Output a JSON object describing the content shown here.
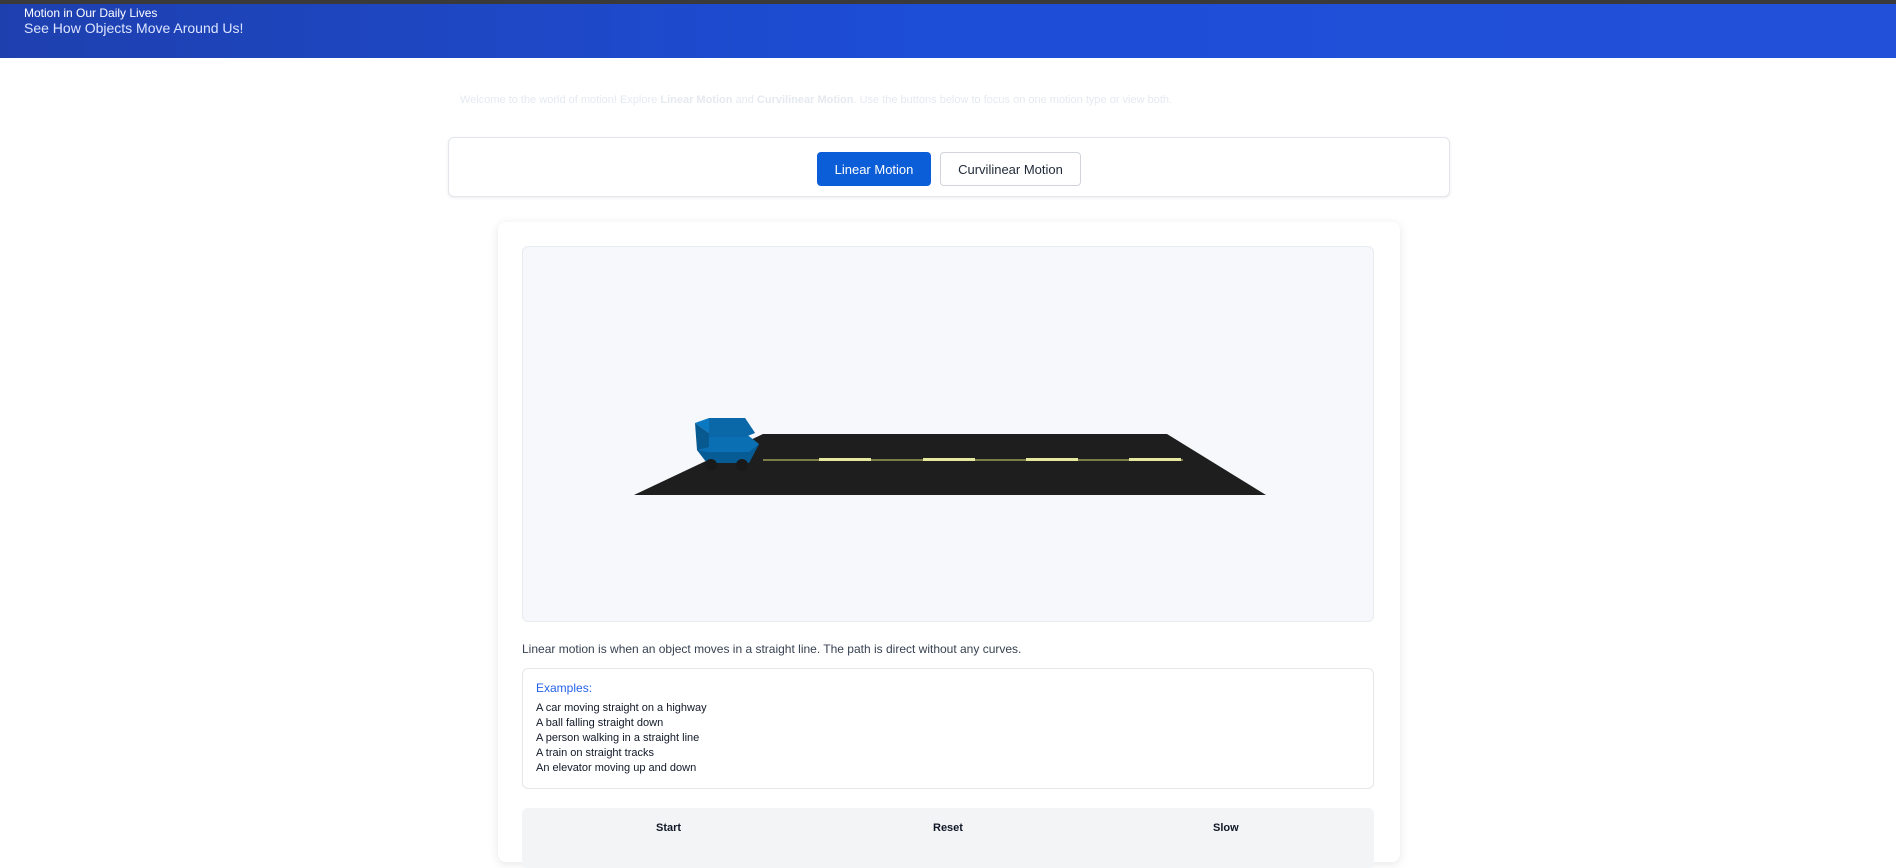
{
  "header": {
    "title": "Motion in Our Daily Lives",
    "subtitle": "See How Objects Move Around Us!"
  },
  "intro": {
    "part1": "Welcome to the world of motion! Explore ",
    "bold1": "Linear Motion",
    "part2": " and ",
    "bold2": "Curvilinear Motion",
    "part3": ". Use the buttons below to focus on one motion type or view both."
  },
  "tabs": [
    {
      "label": "Linear Motion",
      "active": true
    },
    {
      "label": "Curvilinear Motion",
      "active": false
    }
  ],
  "scene": {
    "road_color": "#1e1e1e",
    "car_color": "#0a6fb3",
    "line_color": "#e6e8a0"
  },
  "description": "Linear motion is when an object moves in a straight line. The path is direct without any curves.",
  "examples": {
    "heading": "Examples:",
    "items": [
      "A car moving straight on a highway",
      "A ball falling straight down",
      "A person walking in a straight line",
      "A train on straight tracks",
      "An elevator moving up and down"
    ]
  },
  "controls": {
    "start": "Start",
    "reset": "Reset",
    "slow": "Slow"
  },
  "colors": {
    "header_start": "#1e40af",
    "header_end": "#2350d8",
    "accent": "#0b5ed7"
  }
}
